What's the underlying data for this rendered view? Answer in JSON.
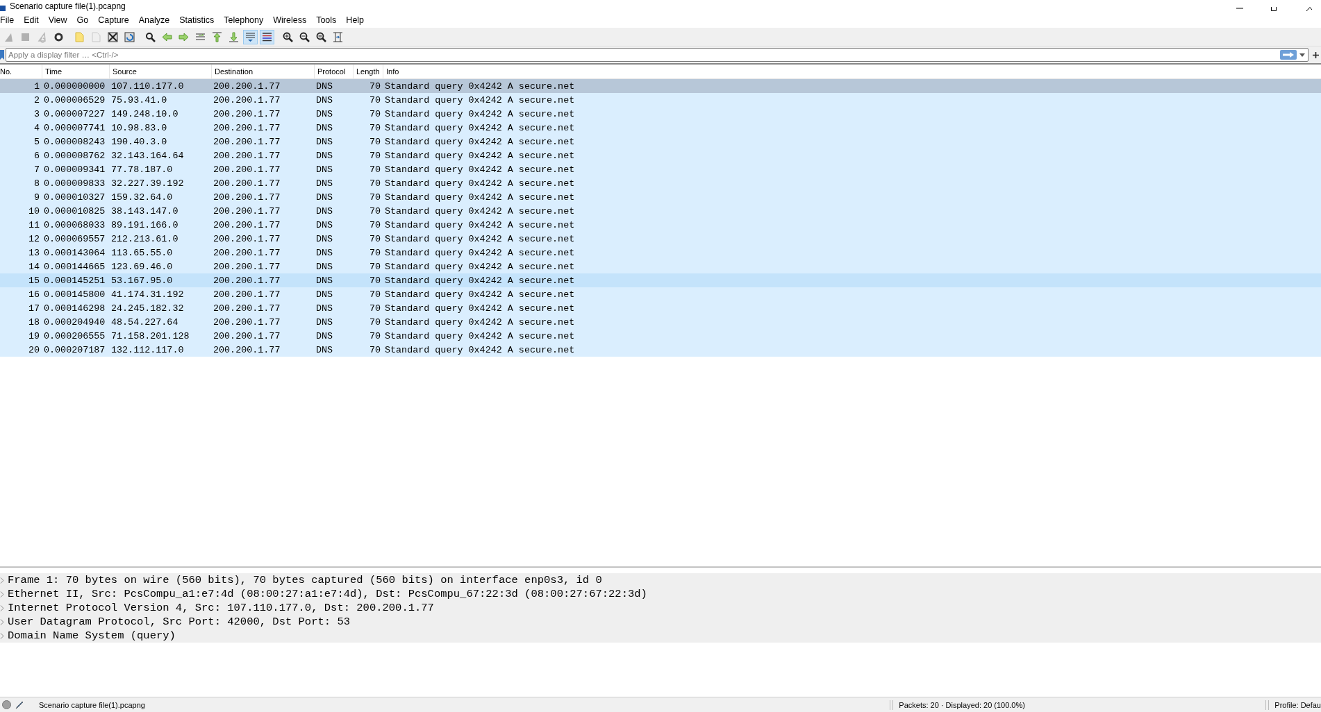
{
  "window": {
    "title": "Scenario capture file(1).pcapng"
  },
  "menu": [
    "File",
    "Edit",
    "View",
    "Go",
    "Capture",
    "Analyze",
    "Statistics",
    "Telephony",
    "Wireless",
    "Tools",
    "Help"
  ],
  "toolbar": [
    {
      "disabled": true,
      "pressed": false
    },
    {
      "disabled": true,
      "pressed": false
    },
    {
      "disabled": true,
      "pressed": false
    },
    {
      "disabled": false,
      "pressed": false
    },
    {
      "disabled": false,
      "pressed": false
    },
    {
      "disabled": true,
      "pressed": false
    },
    {
      "disabled": false,
      "pressed": false
    },
    {
      "disabled": false,
      "pressed": false
    },
    {
      "disabled": false,
      "pressed": false
    },
    {
      "disabled": false,
      "pressed": false
    },
    {
      "disabled": false,
      "pressed": false
    },
    {
      "disabled": false,
      "pressed": false
    },
    {
      "disabled": false,
      "pressed": false
    },
    {
      "disabled": false,
      "pressed": false
    },
    {
      "disabled": false,
      "pressed": true
    },
    {
      "disabled": false,
      "pressed": true
    },
    {
      "disabled": false,
      "pressed": false
    },
    {
      "disabled": false,
      "pressed": false
    },
    {
      "disabled": false,
      "pressed": false
    },
    {
      "disabled": false,
      "pressed": false
    }
  ],
  "filter": {
    "placeholder": "Apply a display filter … <Ctrl-/>"
  },
  "table": {
    "columns": [
      "No.",
      "Time",
      "Source",
      "Destination",
      "Protocol",
      "Length",
      "Info"
    ],
    "rows": [
      {
        "cells": [
          "1",
          "0.000000000",
          "107.110.177.0",
          "200.200.1.77",
          "DNS",
          "70",
          "Standard query 0x4242 A secure.net"
        ],
        "selected": true,
        "hovered": false
      },
      {
        "cells": [
          "2",
          "0.000006529",
          "75.93.41.0",
          "200.200.1.77",
          "DNS",
          "70",
          "Standard query 0x4242 A secure.net"
        ],
        "selected": false,
        "hovered": false
      },
      {
        "cells": [
          "3",
          "0.000007227",
          "149.248.10.0",
          "200.200.1.77",
          "DNS",
          "70",
          "Standard query 0x4242 A secure.net"
        ],
        "selected": false,
        "hovered": false
      },
      {
        "cells": [
          "4",
          "0.000007741",
          "10.98.83.0",
          "200.200.1.77",
          "DNS",
          "70",
          "Standard query 0x4242 A secure.net"
        ],
        "selected": false,
        "hovered": false
      },
      {
        "cells": [
          "5",
          "0.000008243",
          "190.40.3.0",
          "200.200.1.77",
          "DNS",
          "70",
          "Standard query 0x4242 A secure.net"
        ],
        "selected": false,
        "hovered": false
      },
      {
        "cells": [
          "6",
          "0.000008762",
          "32.143.164.64",
          "200.200.1.77",
          "DNS",
          "70",
          "Standard query 0x4242 A secure.net"
        ],
        "selected": false,
        "hovered": false
      },
      {
        "cells": [
          "7",
          "0.000009341",
          "77.78.187.0",
          "200.200.1.77",
          "DNS",
          "70",
          "Standard query 0x4242 A secure.net"
        ],
        "selected": false,
        "hovered": false
      },
      {
        "cells": [
          "8",
          "0.000009833",
          "32.227.39.192",
          "200.200.1.77",
          "DNS",
          "70",
          "Standard query 0x4242 A secure.net"
        ],
        "selected": false,
        "hovered": false
      },
      {
        "cells": [
          "9",
          "0.000010327",
          "159.32.64.0",
          "200.200.1.77",
          "DNS",
          "70",
          "Standard query 0x4242 A secure.net"
        ],
        "selected": false,
        "hovered": false
      },
      {
        "cells": [
          "10",
          "0.000010825",
          "38.143.147.0",
          "200.200.1.77",
          "DNS",
          "70",
          "Standard query 0x4242 A secure.net"
        ],
        "selected": false,
        "hovered": false
      },
      {
        "cells": [
          "11",
          "0.000068033",
          "89.191.166.0",
          "200.200.1.77",
          "DNS",
          "70",
          "Standard query 0x4242 A secure.net"
        ],
        "selected": false,
        "hovered": false
      },
      {
        "cells": [
          "12",
          "0.000069557",
          "212.213.61.0",
          "200.200.1.77",
          "DNS",
          "70",
          "Standard query 0x4242 A secure.net"
        ],
        "selected": false,
        "hovered": false
      },
      {
        "cells": [
          "13",
          "0.000143064",
          "113.65.55.0",
          "200.200.1.77",
          "DNS",
          "70",
          "Standard query 0x4242 A secure.net"
        ],
        "selected": false,
        "hovered": false
      },
      {
        "cells": [
          "14",
          "0.000144665",
          "123.69.46.0",
          "200.200.1.77",
          "DNS",
          "70",
          "Standard query 0x4242 A secure.net"
        ],
        "selected": false,
        "hovered": false
      },
      {
        "cells": [
          "15",
          "0.000145251",
          "53.167.95.0",
          "200.200.1.77",
          "DNS",
          "70",
          "Standard query 0x4242 A secure.net"
        ],
        "selected": false,
        "hovered": true
      },
      {
        "cells": [
          "16",
          "0.000145800",
          "41.174.31.192",
          "200.200.1.77",
          "DNS",
          "70",
          "Standard query 0x4242 A secure.net"
        ],
        "selected": false,
        "hovered": false
      },
      {
        "cells": [
          "17",
          "0.000146298",
          "24.245.182.32",
          "200.200.1.77",
          "DNS",
          "70",
          "Standard query 0x4242 A secure.net"
        ],
        "selected": false,
        "hovered": false
      },
      {
        "cells": [
          "18",
          "0.000204940",
          "48.54.227.64",
          "200.200.1.77",
          "DNS",
          "70",
          "Standard query 0x4242 A secure.net"
        ],
        "selected": false,
        "hovered": false
      },
      {
        "cells": [
          "19",
          "0.000206555",
          "71.158.201.128",
          "200.200.1.77",
          "DNS",
          "70",
          "Standard query 0x4242 A secure.net"
        ],
        "selected": false,
        "hovered": false
      },
      {
        "cells": [
          "20",
          "0.000207187",
          "132.112.117.0",
          "200.200.1.77",
          "DNS",
          "70",
          "Standard query 0x4242 A secure.net"
        ],
        "selected": false,
        "hovered": false
      }
    ]
  },
  "details": [
    {
      "text": "Frame 1: 70 bytes on wire (560 bits), 70 bytes captured (560 bits) on interface enp0s3, id 0",
      "expanded": false
    },
    {
      "text": "Ethernet II, Src: PcsCompu_a1:e7:4d (08:00:27:a1:e7:4d), Dst: PcsCompu_67:22:3d (08:00:27:67:22:3d)",
      "expanded": false
    },
    {
      "text": "Internet Protocol Version 4, Src: 107.110.177.0, Dst: 200.200.1.77",
      "expanded": false
    },
    {
      "text": "User Datagram Protocol, Src Port: 42000, Dst Port: 53",
      "expanded": false
    },
    {
      "text": "Domain Name System (query)",
      "expanded": false
    }
  ],
  "status_bar": {
    "file": "Scenario capture file(1).pcapng",
    "packets": "Packets: 20 · Displayed: 20 (100.0%)",
    "profile": "Profile: Defau"
  }
}
